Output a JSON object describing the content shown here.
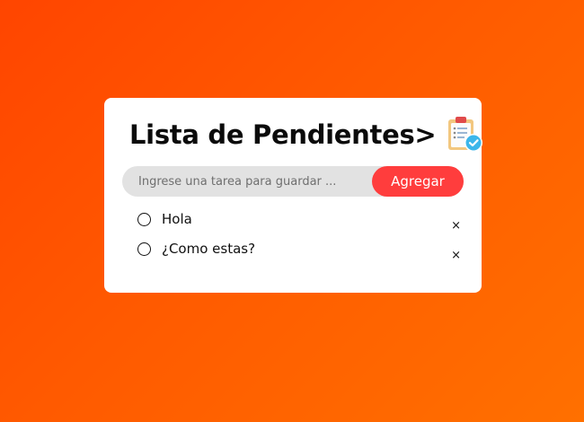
{
  "todo_app": {
    "title": "Lista de Pendientes>",
    "title_icon": "clipboard-check-icon",
    "input": {
      "value": "",
      "placeholder": "Ingrese una tarea para guardar ..."
    },
    "add_button_label": "Agregar",
    "tasks": [
      {
        "text": "Hola",
        "checked": false,
        "remove_label": "×"
      },
      {
        "text": "¿Como estas?",
        "checked": false,
        "remove_label": "×"
      }
    ]
  },
  "colors": {
    "background_gradient_start": "#ff4500",
    "background_gradient_end": "#ff7000",
    "card_background": "#ffffff",
    "input_background": "#e2e2e2",
    "accent_button": "#ff3d3d"
  }
}
